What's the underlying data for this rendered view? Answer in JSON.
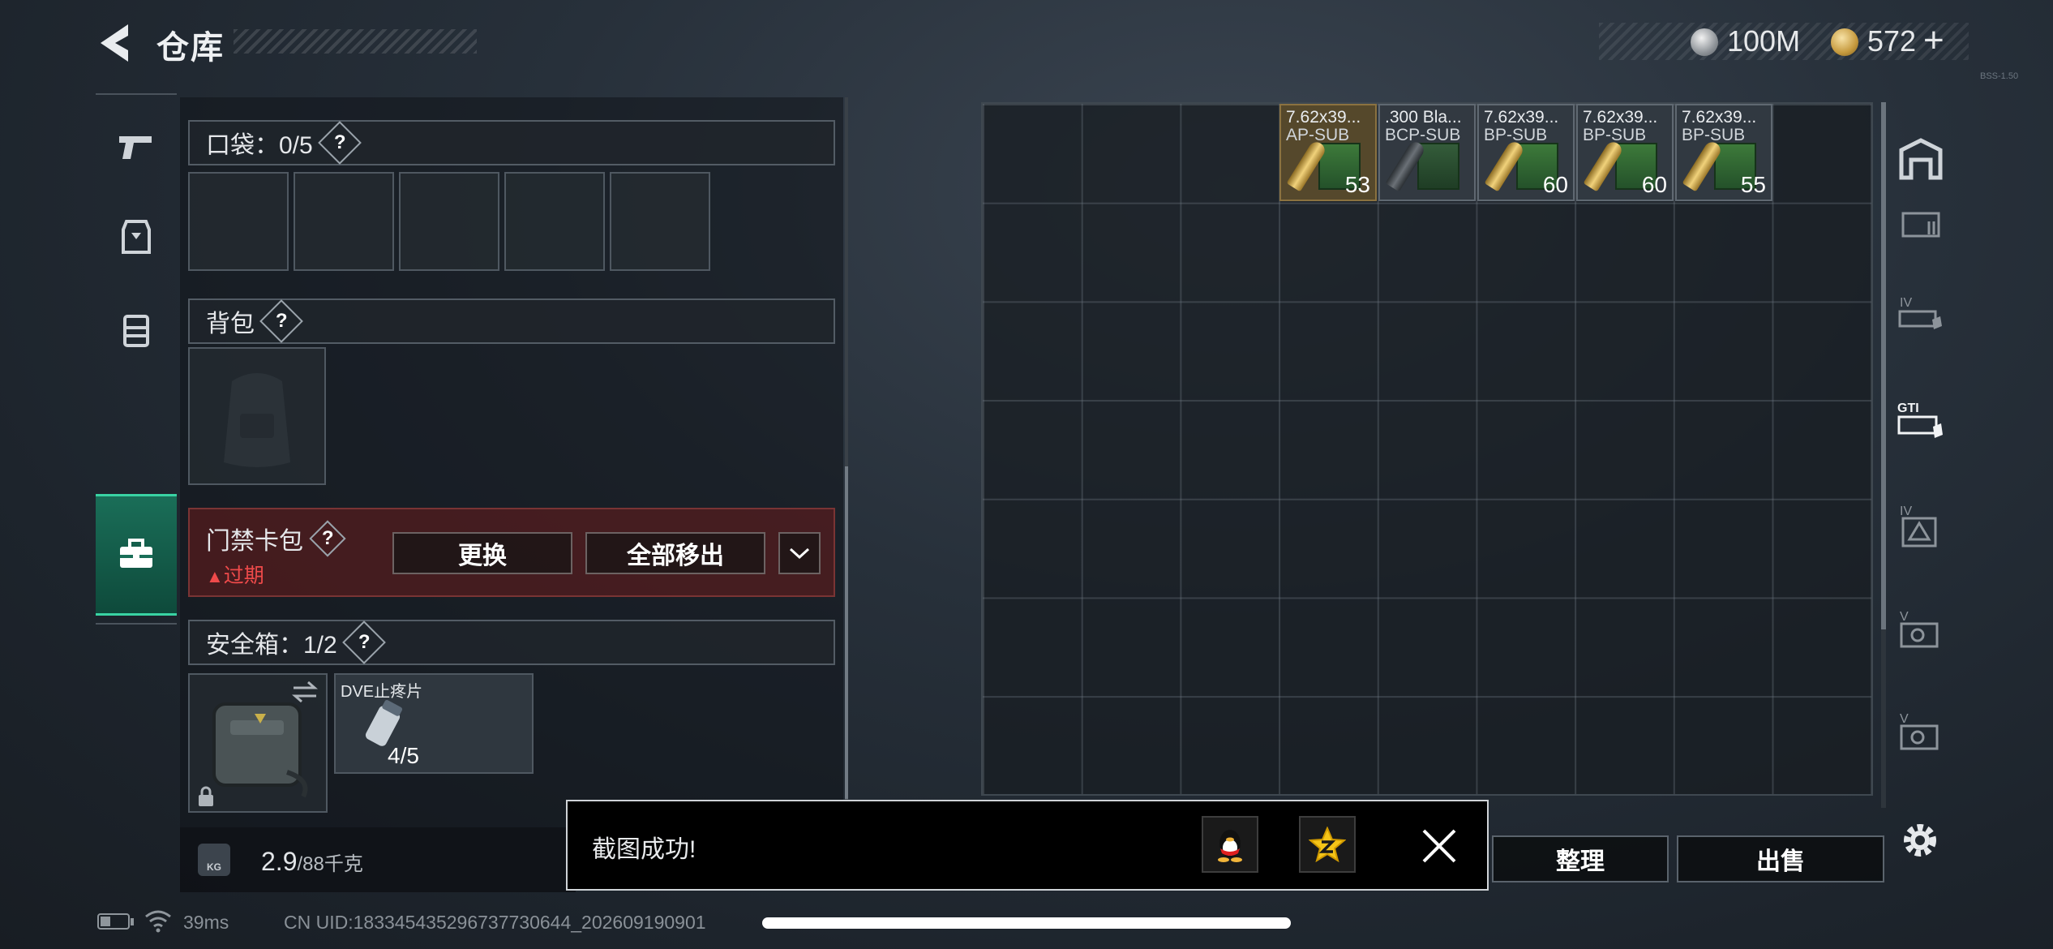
{
  "header": {
    "title": "仓库",
    "currency_primary": "100M",
    "currency_secondary": "572",
    "add_symbol": "+",
    "corner_label": "BSS-1.50"
  },
  "left_sidebar": {
    "tabs": [
      {
        "name": "weapon",
        "icon": "pistol-icon",
        "active": false
      },
      {
        "name": "armor",
        "icon": "vest-icon",
        "active": false
      },
      {
        "name": "chest-rig",
        "icon": "rig-icon",
        "active": false
      },
      {
        "name": "containers",
        "icon": "toolbox-icon",
        "active": true
      }
    ]
  },
  "pockets": {
    "label": "口袋：0/5",
    "help": "?",
    "slot_count": 5
  },
  "backpack": {
    "label": "背包",
    "help": "?"
  },
  "keycard_pack": {
    "label": "门禁卡包",
    "help": "?",
    "status": "过期",
    "status_color": "#ee4a4a",
    "replace_label": "更换",
    "remove_all_label": "全部移出",
    "expand_icon": "chevron-down-icon"
  },
  "safe_box": {
    "label": "安全箱：1/2",
    "help": "?",
    "item": {
      "name": "DVE止疼片",
      "count": "4/5"
    }
  },
  "weight": {
    "icon_label": "KG",
    "current": "2.9",
    "capacity": "/88千克"
  },
  "storage": {
    "items": [
      {
        "name": "7.62x39...",
        "sub": "AP-SUB",
        "count": "53",
        "rarity": "gold"
      },
      {
        "name": ".300 Bla...",
        "sub": "BCP-SUB",
        "count": "",
        "rarity": "normal"
      },
      {
        "name": "7.62x39...",
        "sub": "BP-SUB",
        "count": "60",
        "rarity": "normal"
      },
      {
        "name": "7.62x39...",
        "sub": "BP-SUB",
        "count": "60",
        "rarity": "normal"
      },
      {
        "name": "7.62x39...",
        "sub": "BP-SUB",
        "count": "55",
        "rarity": "normal"
      }
    ]
  },
  "right_sidebar": {
    "tabs": [
      {
        "name": "all",
        "icon": "warehouse-icon"
      },
      {
        "name": "ext-1",
        "icon": "expansion-box-icon"
      },
      {
        "name": "ext-2",
        "icon": "expansion-box-iv-icon"
      },
      {
        "name": "ext-3",
        "icon": "expansion-box-gti-icon"
      },
      {
        "name": "ext-4",
        "icon": "expansion-box-iv-triangle-icon"
      },
      {
        "name": "ext-5",
        "icon": "expansion-box-v-icon"
      },
      {
        "name": "ext-6",
        "icon": "expansion-box-v2-icon"
      }
    ]
  },
  "actions": {
    "organize_label": "整理",
    "sell_label": "出售"
  },
  "toast": {
    "message": "截图成功!"
  },
  "status_bar": {
    "ping": "39ms",
    "uid": "CN UID:1833454352967377306​44_2026091909​01"
  }
}
